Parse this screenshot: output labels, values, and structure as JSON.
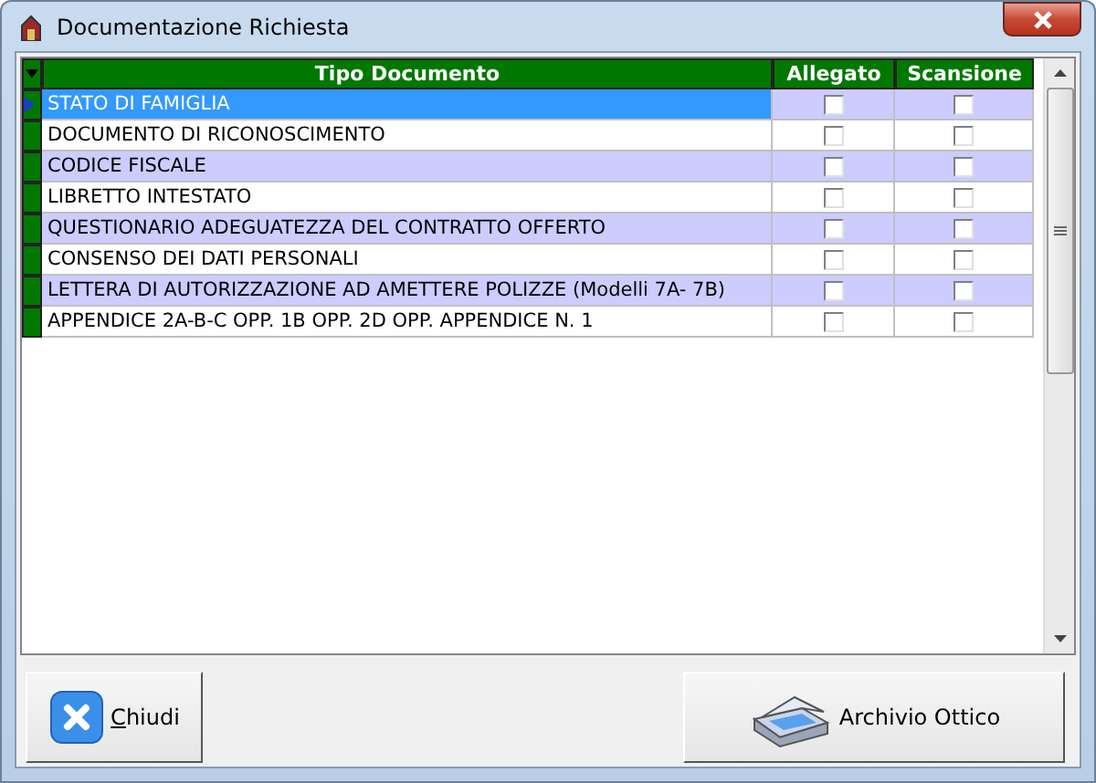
{
  "window": {
    "title": "Documentazione Richiesta"
  },
  "table": {
    "columns": [
      "Tipo Documento",
      "Allegato",
      "Scansione"
    ],
    "rows": [
      {
        "tipo": "STATO DI FAMIGLIA",
        "selected": true,
        "allegato": false,
        "scansione": false
      },
      {
        "tipo": "DOCUMENTO DI RICONOSCIMENTO",
        "selected": false,
        "allegato": false,
        "scansione": false
      },
      {
        "tipo": "CODICE FISCALE",
        "selected": false,
        "allegato": false,
        "scansione": false
      },
      {
        "tipo": "LIBRETTO INTESTATO",
        "selected": false,
        "allegato": false,
        "scansione": false
      },
      {
        "tipo": "QUESTIONARIO ADEGUATEZZA DEL CONTRATTO OFFERTO",
        "selected": false,
        "allegato": false,
        "scansione": false
      },
      {
        "tipo": "CONSENSO DEI DATI PERSONALI",
        "selected": false,
        "allegato": false,
        "scansione": false
      },
      {
        "tipo": "LETTERA DI AUTORIZZAZIONE AD AMETTERE POLIZZE (Modelli 7A- 7B)",
        "selected": false,
        "allegato": false,
        "scansione": false
      },
      {
        "tipo": "APPENDICE 2A-B-C OPP. 1B OPP. 2D OPP. APPENDICE N. 1",
        "selected": false,
        "allegato": false,
        "scansione": false
      }
    ]
  },
  "buttons": [
    {
      "kind": "close",
      "label": "Chiudi",
      "mnemonic_underlined": true
    },
    {
      "kind": "scanner",
      "label": "Archivio Ottico"
    }
  ]
}
